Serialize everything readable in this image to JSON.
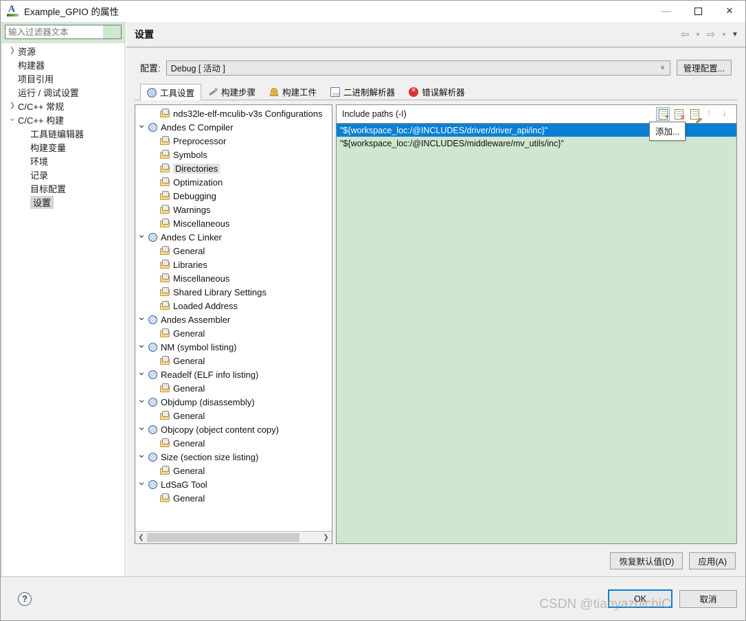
{
  "window": {
    "title": "Example_GPIO 的属性",
    "app_icon": "eclipse-app-icon",
    "minimize": "—",
    "maximize": "",
    "close": "✕"
  },
  "sidebar": {
    "filter": {
      "value": "",
      "placeholder": "输入过滤器文本"
    },
    "items": [
      {
        "label": "资源",
        "expander": "right",
        "level": 0,
        "selected": false
      },
      {
        "label": "构建器",
        "expander": "none",
        "level": 0,
        "selected": false
      },
      {
        "label": "项目引用",
        "expander": "none",
        "level": 0,
        "selected": false
      },
      {
        "label": "运行 / 调试设置",
        "expander": "none",
        "level": 0,
        "selected": false
      },
      {
        "label": "C/C++ 常规",
        "expander": "right",
        "level": 0,
        "selected": false
      },
      {
        "label": "C/C++ 构建",
        "expander": "down",
        "level": 0,
        "selected": false
      },
      {
        "label": "工具链编辑器",
        "expander": "none",
        "level": 1,
        "selected": false
      },
      {
        "label": "构建变量",
        "expander": "none",
        "level": 1,
        "selected": false
      },
      {
        "label": "环境",
        "expander": "none",
        "level": 1,
        "selected": false
      },
      {
        "label": "记录",
        "expander": "none",
        "level": 1,
        "selected": false
      },
      {
        "label": "目标配置",
        "expander": "none",
        "level": 1,
        "selected": false
      },
      {
        "label": "设置",
        "expander": "none",
        "level": 1,
        "selected": true
      }
    ]
  },
  "header": {
    "title": "设置",
    "nav": {
      "back_icon": "back-arrow-icon",
      "back_caret": "▼",
      "forward_icon": "forward-arrow-icon",
      "forward_caret": "▼",
      "menu_caret": "▼"
    }
  },
  "config": {
    "label": "配置:",
    "value": "Debug  [ 活动 ]",
    "caret": "∨",
    "manage_button": "管理配置..."
  },
  "tabs": [
    {
      "label": "工具设置",
      "icon": "toolsettings-icon",
      "active": true
    },
    {
      "label": "构建步骤",
      "icon": "wrench-icon",
      "active": false
    },
    {
      "label": "构建工件",
      "icon": "artifact-icon",
      "active": false
    },
    {
      "label": "二进制解析器",
      "icon": "binary-parser-icon",
      "active": false
    },
    {
      "label": "错误解析器",
      "icon": "error-parser-icon",
      "active": false
    }
  ],
  "tool_tree": {
    "rows": [
      {
        "label": "nds32le-elf-mculib-v3s Configurations",
        "icon": "folder-icon",
        "expander": "none",
        "indent": 1,
        "selected": false
      },
      {
        "label": "Andes C Compiler",
        "icon": "tool-icon",
        "expander": "down",
        "indent": 0,
        "selected": false
      },
      {
        "label": "Preprocessor",
        "icon": "folder-icon",
        "expander": "none",
        "indent": 1,
        "selected": false
      },
      {
        "label": "Symbols",
        "icon": "folder-icon",
        "expander": "none",
        "indent": 1,
        "selected": false
      },
      {
        "label": "Directories",
        "icon": "folder-icon",
        "expander": "none",
        "indent": 1,
        "selected": true
      },
      {
        "label": "Optimization",
        "icon": "folder-icon",
        "expander": "none",
        "indent": 1,
        "selected": false
      },
      {
        "label": "Debugging",
        "icon": "folder-icon",
        "expander": "none",
        "indent": 1,
        "selected": false
      },
      {
        "label": "Warnings",
        "icon": "folder-icon",
        "expander": "none",
        "indent": 1,
        "selected": false
      },
      {
        "label": "Miscellaneous",
        "icon": "folder-icon",
        "expander": "none",
        "indent": 1,
        "selected": false
      },
      {
        "label": "Andes C Linker",
        "icon": "tool-icon",
        "expander": "down",
        "indent": 0,
        "selected": false
      },
      {
        "label": "General",
        "icon": "folder-icon",
        "expander": "none",
        "indent": 1,
        "selected": false
      },
      {
        "label": "Libraries",
        "icon": "folder-icon",
        "expander": "none",
        "indent": 1,
        "selected": false
      },
      {
        "label": "Miscellaneous",
        "icon": "folder-icon",
        "expander": "none",
        "indent": 1,
        "selected": false
      },
      {
        "label": "Shared Library Settings",
        "icon": "folder-icon",
        "expander": "none",
        "indent": 1,
        "selected": false
      },
      {
        "label": "Loaded Address",
        "icon": "folder-icon",
        "expander": "none",
        "indent": 1,
        "selected": false
      },
      {
        "label": "Andes Assembler",
        "icon": "tool-icon",
        "expander": "down",
        "indent": 0,
        "selected": false
      },
      {
        "label": "General",
        "icon": "folder-icon",
        "expander": "none",
        "indent": 1,
        "selected": false
      },
      {
        "label": "NM (symbol listing)",
        "icon": "tool-icon",
        "expander": "down",
        "indent": 0,
        "selected": false
      },
      {
        "label": "General",
        "icon": "folder-icon",
        "expander": "none",
        "indent": 1,
        "selected": false
      },
      {
        "label": "Readelf (ELF info listing)",
        "icon": "tool-icon",
        "expander": "down",
        "indent": 0,
        "selected": false
      },
      {
        "label": "General",
        "icon": "folder-icon",
        "expander": "none",
        "indent": 1,
        "selected": false
      },
      {
        "label": "Objdump (disassembly)",
        "icon": "tool-icon",
        "expander": "down",
        "indent": 0,
        "selected": false
      },
      {
        "label": "General",
        "icon": "folder-icon",
        "expander": "none",
        "indent": 1,
        "selected": false
      },
      {
        "label": "Objcopy (object content copy)",
        "icon": "tool-icon",
        "expander": "down",
        "indent": 0,
        "selected": false
      },
      {
        "label": "General",
        "icon": "folder-icon",
        "expander": "none",
        "indent": 1,
        "selected": false
      },
      {
        "label": "Size (section size listing)",
        "icon": "tool-icon",
        "expander": "down",
        "indent": 0,
        "selected": false
      },
      {
        "label": "General",
        "icon": "folder-icon",
        "expander": "none",
        "indent": 1,
        "selected": false
      },
      {
        "label": "LdSaG Tool",
        "icon": "tool-icon",
        "expander": "down",
        "indent": 0,
        "selected": false
      },
      {
        "label": "General",
        "icon": "folder-icon",
        "expander": "none",
        "indent": 1,
        "selected": false
      }
    ],
    "hscroll_left": "❮",
    "hscroll_right": "❯"
  },
  "include_panel": {
    "title": "Include paths (-I)",
    "toolbar": [
      {
        "name": "add-icon",
        "state": "highlighted"
      },
      {
        "name": "delete-icon",
        "state": "normal"
      },
      {
        "name": "edit-icon",
        "state": "normal"
      },
      {
        "name": "move-up-icon",
        "state": "disabled"
      },
      {
        "name": "move-down-icon",
        "state": "normal"
      }
    ],
    "tooltip": "添加...",
    "rows": [
      {
        "value": "\"${workspace_loc:/@INCLUDES/driver/driver_api/inc}\"",
        "selected": true
      },
      {
        "value": "\"${workspace_loc:/@INCLUDES/middleware/mv_utils/inc}\"",
        "selected": false
      }
    ]
  },
  "actions": {
    "restore_defaults": "恢复默认值(D)",
    "apply": "应用(A)"
  },
  "footer": {
    "help_icon": "help-icon",
    "help_glyph": "?",
    "ok": "OK",
    "cancel": "取消",
    "watermark": "CSDN @tianyazhichiC"
  },
  "colors": {
    "selection_blue": "#0b7fd4",
    "list_green": "#cfe6cf",
    "sidebar_green": "#d4e8d4",
    "dialog_grey": "#f0f0f0"
  }
}
